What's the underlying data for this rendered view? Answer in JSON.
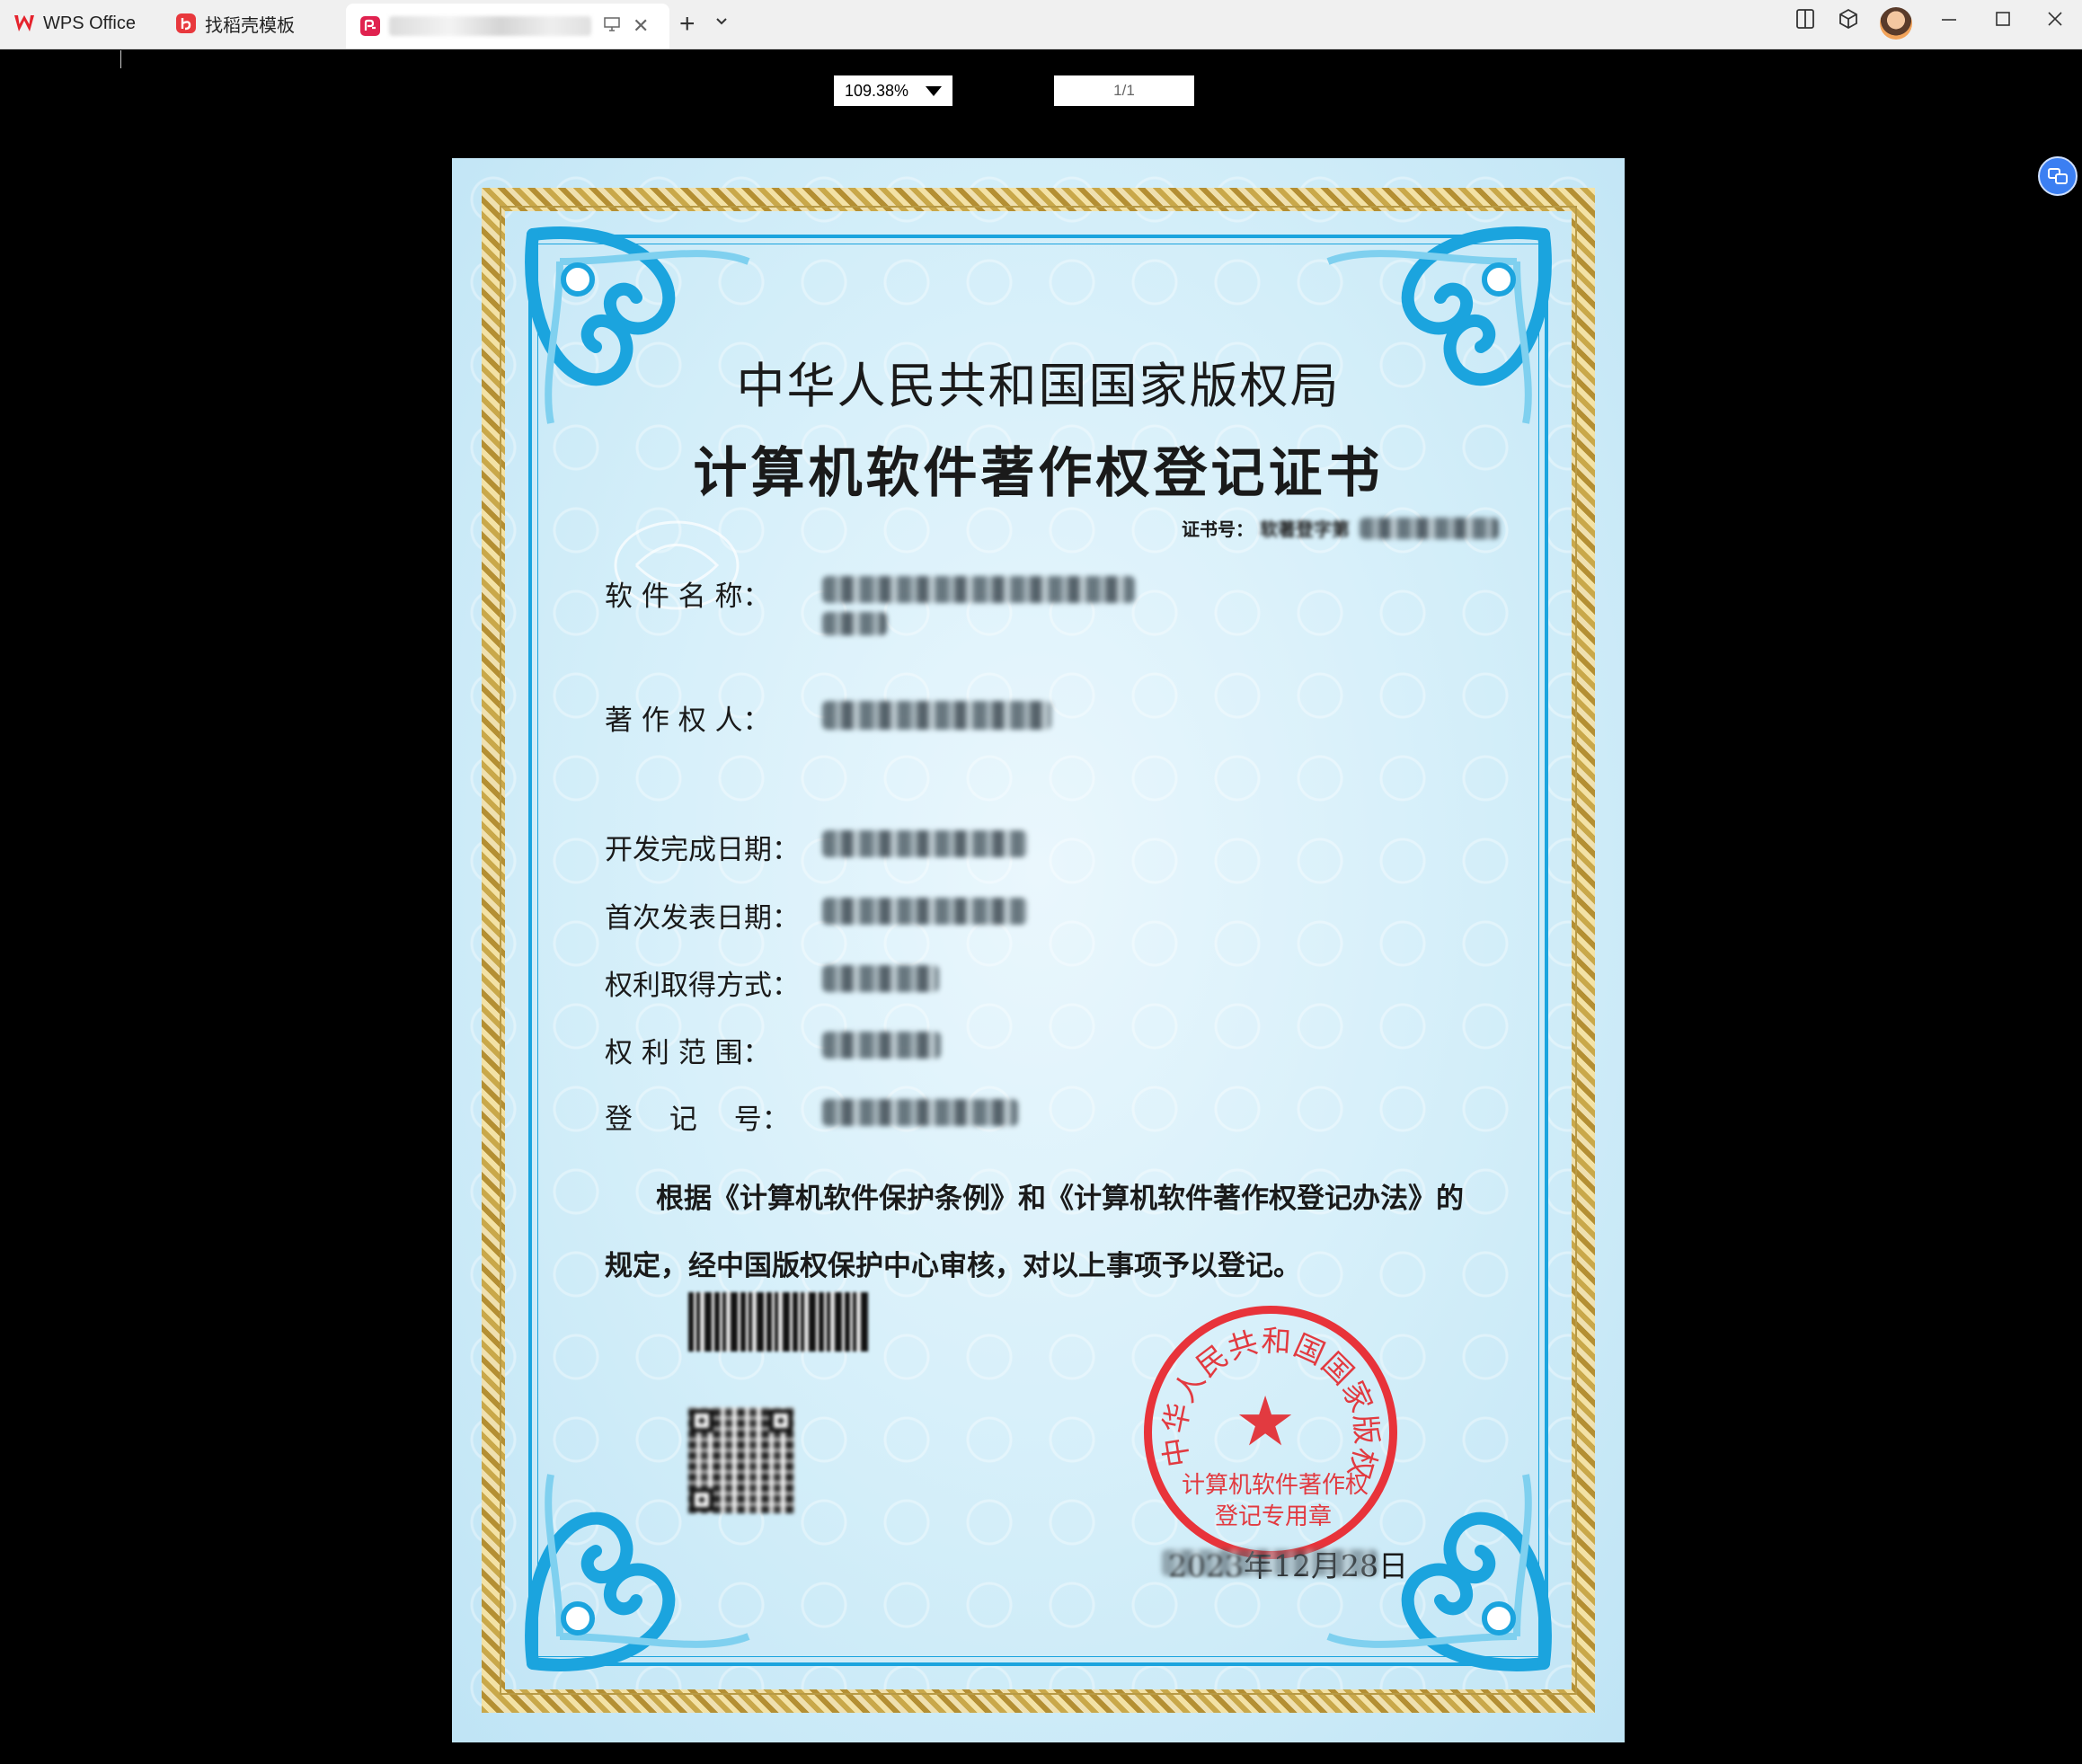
{
  "titlebar": {
    "tabs": [
      {
        "label": "WPS Office",
        "icon": "wps-logo-icon"
      },
      {
        "label": "找稻壳模板",
        "icon": "docer-logo-icon"
      },
      {
        "label": "",
        "icon": "pdf-logo-icon",
        "status_icon": "monitor-icon",
        "close": "✕"
      }
    ],
    "new_tab": "+",
    "new_tab_menu": "⌄",
    "window_controls": {
      "minimize": "—",
      "maximize": "☐",
      "close": "✕"
    }
  },
  "viewer": {
    "zoom_value": "109.38%",
    "page_indicator": "1/1"
  },
  "certificate": {
    "title_org": "中华人民共和国国家版权局",
    "title_doc": "计算机软件著作权登记证书",
    "cert_no_label": "证书号：",
    "cert_no_value": "软著登字第",
    "fields": [
      {
        "label": "软 件 名 称：",
        "value": ""
      },
      {
        "label": "著 作 权 人：",
        "value": ""
      },
      {
        "label": "开发完成日期：",
        "value": ""
      },
      {
        "label": "首次发表日期：",
        "value": ""
      },
      {
        "label": "权利取得方式：",
        "value": ""
      },
      {
        "label": "权 利 范 围：",
        "value": ""
      },
      {
        "label": "登　 记 　号：",
        "value": ""
      }
    ],
    "statement_line1": "根据《计算机软件保护条例》和《计算机软件著作权登记办法》的",
    "statement_line2": "规定，经中国版权保护中心审核，对以上事项予以登记。",
    "seal": {
      "arc_text": "中华人民共和国国家版权局",
      "star": "★",
      "line1": "计算机软件著作权",
      "line2": "登记专用章"
    },
    "date_suffix": "年12月28日",
    "date_prefix": "2023"
  },
  "colors": {
    "frame_blue": "#1ba4de",
    "seal_red": "#e8333a",
    "gold": "#c9a84a"
  }
}
